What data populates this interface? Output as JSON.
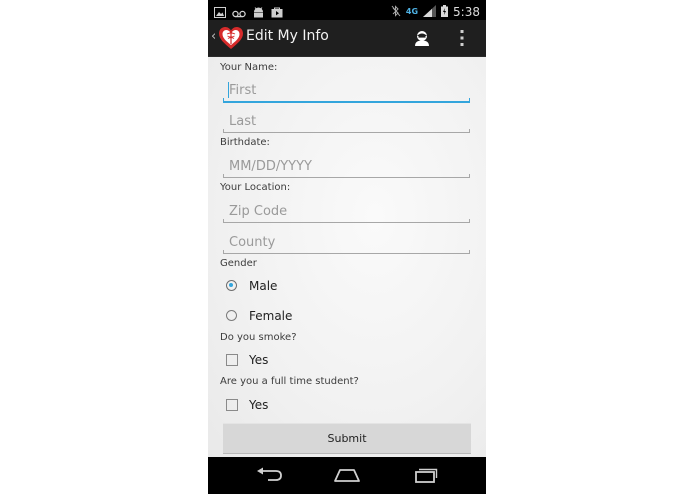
{
  "status_bar": {
    "time": "5:38",
    "network": "4G",
    "icons": [
      "gallery-icon",
      "voicemail-icon",
      "android-icon",
      "play-store-icon",
      "bluetooth-off-icon",
      "signal-icon",
      "battery-charging-icon"
    ]
  },
  "action_bar": {
    "title": "Edit My Info",
    "app_icon": "heart-caduceus-icon",
    "actions": [
      "profile-icon",
      "overflow-menu-icon"
    ]
  },
  "form": {
    "name_label": "Your Name:",
    "first_placeholder": "First",
    "last_placeholder": "Last",
    "birthdate_label": "Birthdate:",
    "birthdate_placeholder": "MM/DD/YYYY",
    "location_label": "Your Location:",
    "zip_placeholder": "Zip Code",
    "county_placeholder": "County",
    "gender_label": "Gender",
    "gender_options": [
      {
        "label": "Male",
        "checked": true
      },
      {
        "label": "Female",
        "checked": false
      }
    ],
    "smoke_label": "Do you smoke?",
    "smoke_option": "Yes",
    "student_label": "Are you a full time student?",
    "student_option": "Yes",
    "submit_label": "Submit"
  },
  "colors": {
    "accent": "#33a5dc",
    "action_bar": "#1f1f1f",
    "background": "#f1f1f1"
  },
  "nav_bar": [
    "back-icon",
    "home-icon",
    "recent-apps-icon"
  ]
}
